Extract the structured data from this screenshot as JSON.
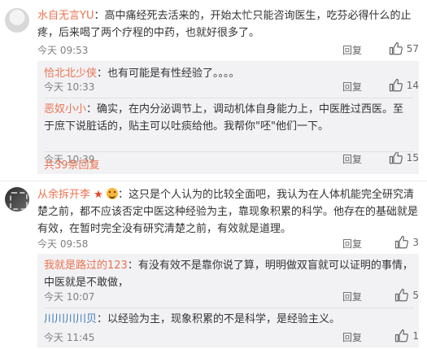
{
  "comments": [
    {
      "user": "水自无言YU",
      "text": "：高中痛经死去活来的，开始太忙只能咨询医生，吃芬必得什么的止疼，后来喝了两个疗程的中药，也就好很多了。",
      "time": "今天 09:53",
      "reply_label": "回复",
      "likes": "57",
      "replies": [
        {
          "user": "恰北北少侠",
          "text": "：也有可能是有性经验了。。。。",
          "time": "今天 10:33",
          "reply_label": "回复",
          "likes": "14"
        },
        {
          "user": "恶奴小小",
          "text": "：确实，在内分泌调节上，调动机体自身能力上，中医胜过西医。至于庶下说脏话的，贴主可以吐痰给他。我帮你\"呸\"他们一下。",
          "time": "今天 10:39",
          "reply_label": "回复",
          "likes": "15"
        }
      ],
      "more_replies": "共39条回复"
    },
    {
      "user": "从余拆开李",
      "text": "：这只是个人认为的比较全面吧，我认为在人体机能完全研究清楚之前，都不应该否定中医这种经验为主，靠现象积累的科学。他存在的基础就是有效，在暂时完全没有研究清楚之前，有效就是道理。",
      "time": "今天 09:58",
      "reply_label": "回复",
      "likes": "3",
      "replies": [
        {
          "user": "我就是路过的123",
          "text": "：有没有效不是靠你说了算，明明做双盲就可以证明的事情，中医就是不敢做，",
          "time": "今天 10:07",
          "reply_label": "回复",
          "likes": "5"
        },
        {
          "user": "川川川川贝",
          "text": "：以经验为主，现象积累的不是科学，是经验主义。",
          "time": "今天 11:45",
          "reply_label": "回复",
          "likes": "1"
        }
      ]
    }
  ],
  "colors": {
    "username": "#eb7350",
    "link_blue": "#3a7ab8",
    "sub_bg": "#f2f2f5",
    "meta": "#808080"
  },
  "icons": {
    "like": "thumbs-up-icon",
    "badge_star": "star-icon",
    "badge_emoji": "smile-icon"
  }
}
